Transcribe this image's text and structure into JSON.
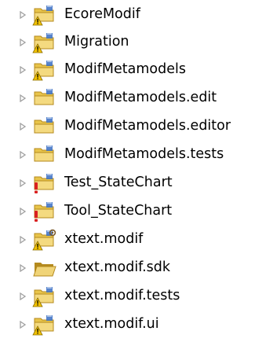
{
  "tree": {
    "items": [
      {
        "label": "EcoreModif",
        "icon": "folder-warning-icon",
        "decor": "warning"
      },
      {
        "label": "Migration",
        "icon": "folder-warning-icon",
        "decor": "warning"
      },
      {
        "label": "ModifMetamodels",
        "icon": "folder-warning-icon",
        "decor": "warning"
      },
      {
        "label": "ModifMetamodels.edit",
        "icon": "folder-icon",
        "decor": "none"
      },
      {
        "label": "ModifMetamodels.editor",
        "icon": "folder-icon",
        "decor": "none"
      },
      {
        "label": "ModifMetamodels.tests",
        "icon": "folder-icon",
        "decor": "none"
      },
      {
        "label": "Test_StateChart",
        "icon": "folder-error-icon",
        "decor": "error"
      },
      {
        "label": "Tool_StateChart",
        "icon": "folder-error-icon",
        "decor": "error"
      },
      {
        "label": "xtext.modif",
        "icon": "folder-warning-icon",
        "decor": "warning-gear"
      },
      {
        "label": "xtext.modif.sdk",
        "icon": "open-folder-icon",
        "decor": "plain"
      },
      {
        "label": "xtext.modif.tests",
        "icon": "folder-warning-icon",
        "decor": "warning"
      },
      {
        "label": "xtext.modif.ui",
        "icon": "folder-warning-icon",
        "decor": "warning"
      }
    ]
  },
  "colors": {
    "folder": "#e8c44a",
    "folder_dark": "#b48a1e",
    "jar_blue": "#3a6fc4",
    "warning": "#f2c200",
    "error": "#d92020",
    "twisty": "#a0a0a0"
  }
}
